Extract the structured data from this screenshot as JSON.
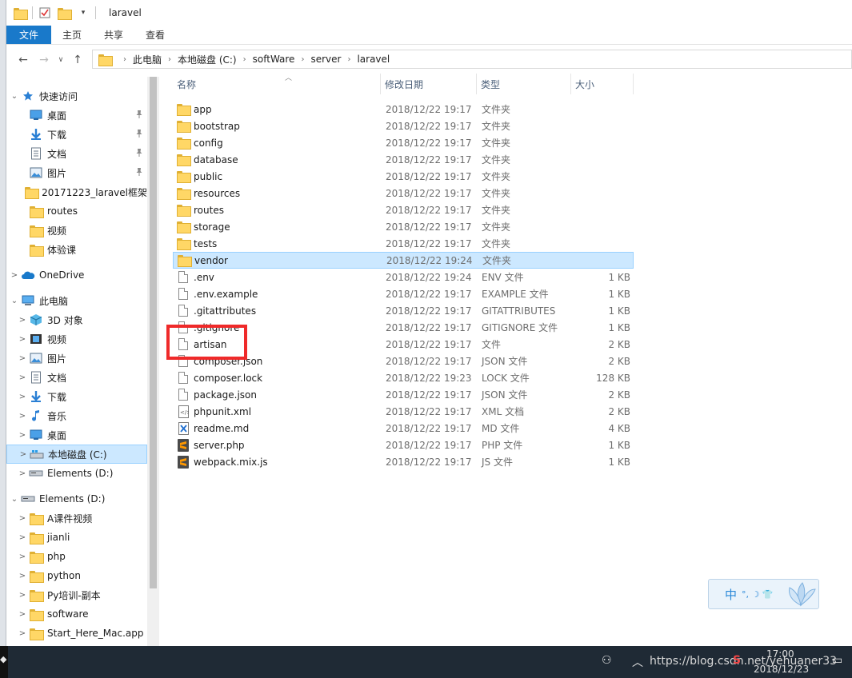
{
  "window": {
    "title": "laravel"
  },
  "ribbon": {
    "tabs": [
      "文件",
      "主页",
      "共享",
      "查看"
    ]
  },
  "address": {
    "crumbs": [
      "此电脑",
      "本地磁盘 (C:)",
      "softWare",
      "server",
      "laravel"
    ]
  },
  "sidebar": {
    "items": [
      {
        "label": "快速访问",
        "icon": "star-icon",
        "caret": "⌄",
        "pinned": false,
        "selected": false
      },
      {
        "label": "桌面",
        "icon": "desktop-icon",
        "caret": "",
        "pinned": true,
        "selected": false
      },
      {
        "label": "下载",
        "icon": "download-arrow-icon",
        "caret": "",
        "pinned": true,
        "selected": false
      },
      {
        "label": "文档",
        "icon": "document-icon",
        "caret": "",
        "pinned": true,
        "selected": false
      },
      {
        "label": "图片",
        "icon": "picture-icon",
        "caret": "",
        "pinned": true,
        "selected": false
      },
      {
        "label": "20171223_laravel框架",
        "icon": "folder-icon",
        "caret": "",
        "pinned": false,
        "selected": false
      },
      {
        "label": "routes",
        "icon": "folder-icon",
        "caret": "",
        "pinned": false,
        "selected": false
      },
      {
        "label": "视频",
        "icon": "folder-icon",
        "caret": "",
        "pinned": false,
        "selected": false
      },
      {
        "label": "体验课",
        "icon": "folder-icon",
        "caret": "",
        "pinned": false,
        "selected": false
      },
      {
        "label": "OneDrive",
        "icon": "cloud-icon",
        "caret": ">",
        "pinned": false,
        "selected": false
      },
      {
        "label": "此电脑",
        "icon": "computer-icon",
        "caret": "⌄",
        "pinned": false,
        "selected": false
      },
      {
        "label": "3D 对象",
        "icon": "cube-3d-icon",
        "caret": ">",
        "pinned": false,
        "selected": false
      },
      {
        "label": "视频",
        "icon": "video-icon",
        "caret": ">",
        "pinned": false,
        "selected": false
      },
      {
        "label": "图片",
        "icon": "picture-icon",
        "caret": ">",
        "pinned": false,
        "selected": false
      },
      {
        "label": "文档",
        "icon": "document-icon",
        "caret": ">",
        "pinned": false,
        "selected": false
      },
      {
        "label": "下载",
        "icon": "download-arrow-icon",
        "caret": ">",
        "pinned": false,
        "selected": false
      },
      {
        "label": "音乐",
        "icon": "music-note-icon",
        "caret": ">",
        "pinned": false,
        "selected": false
      },
      {
        "label": "桌面",
        "icon": "desktop-icon",
        "caret": ">",
        "pinned": false,
        "selected": false
      },
      {
        "label": "本地磁盘 (C:)",
        "icon": "drive-c-icon",
        "caret": ">",
        "pinned": false,
        "selected": true
      },
      {
        "label": "Elements (D:)",
        "icon": "drive-icon",
        "caret": ">",
        "pinned": false,
        "selected": false
      },
      {
        "label": "Elements (D:)",
        "icon": "drive-icon",
        "caret": "⌄",
        "pinned": false,
        "selected": false
      },
      {
        "label": "A课件视频",
        "icon": "folder-icon",
        "caret": ">",
        "pinned": false,
        "selected": false
      },
      {
        "label": "jianli",
        "icon": "folder-icon",
        "caret": ">",
        "pinned": false,
        "selected": false
      },
      {
        "label": "php",
        "icon": "folder-icon",
        "caret": ">",
        "pinned": false,
        "selected": false
      },
      {
        "label": "python",
        "icon": "folder-icon",
        "caret": ">",
        "pinned": false,
        "selected": false
      },
      {
        "label": "Py培训-副本",
        "icon": "folder-icon",
        "caret": ">",
        "pinned": false,
        "selected": false
      },
      {
        "label": "software",
        "icon": "folder-icon",
        "caret": ">",
        "pinned": false,
        "selected": false
      },
      {
        "label": "Start_Here_Mac.app",
        "icon": "folder-icon",
        "caret": ">",
        "pinned": false,
        "selected": false
      }
    ]
  },
  "columns": {
    "name": "名称",
    "date": "修改日期",
    "type": "类型",
    "size": "大小"
  },
  "files": [
    {
      "name": "app",
      "date": "2018/12/22 19:17",
      "type": "文件夹",
      "size": "",
      "icon": "folder-icon"
    },
    {
      "name": "bootstrap",
      "date": "2018/12/22 19:17",
      "type": "文件夹",
      "size": "",
      "icon": "folder-icon"
    },
    {
      "name": "config",
      "date": "2018/12/22 19:17",
      "type": "文件夹",
      "size": "",
      "icon": "folder-icon"
    },
    {
      "name": "database",
      "date": "2018/12/22 19:17",
      "type": "文件夹",
      "size": "",
      "icon": "folder-icon"
    },
    {
      "name": "public",
      "date": "2018/12/22 19:17",
      "type": "文件夹",
      "size": "",
      "icon": "folder-icon"
    },
    {
      "name": "resources",
      "date": "2018/12/22 19:17",
      "type": "文件夹",
      "size": "",
      "icon": "folder-icon"
    },
    {
      "name": "routes",
      "date": "2018/12/22 19:17",
      "type": "文件夹",
      "size": "",
      "icon": "folder-icon"
    },
    {
      "name": "storage",
      "date": "2018/12/22 19:17",
      "type": "文件夹",
      "size": "",
      "icon": "folder-icon"
    },
    {
      "name": "tests",
      "date": "2018/12/22 19:17",
      "type": "文件夹",
      "size": "",
      "icon": "folder-icon"
    },
    {
      "name": "vendor",
      "date": "2018/12/22 19:24",
      "type": "文件夹",
      "size": "",
      "icon": "folder-icon",
      "selected": true
    },
    {
      "name": ".env",
      "date": "2018/12/22 19:24",
      "type": "ENV 文件",
      "size": "1 KB",
      "icon": "file-icon"
    },
    {
      "name": ".env.example",
      "date": "2018/12/22 19:17",
      "type": "EXAMPLE 文件",
      "size": "1 KB",
      "icon": "file-icon"
    },
    {
      "name": ".gitattributes",
      "date": "2018/12/22 19:17",
      "type": "GITATTRIBUTES",
      "size": "1 KB",
      "icon": "file-icon"
    },
    {
      "name": ".gitignore",
      "date": "2018/12/22 19:17",
      "type": "GITIGNORE 文件",
      "size": "1 KB",
      "icon": "file-icon"
    },
    {
      "name": "artisan",
      "date": "2018/12/22 19:17",
      "type": "文件",
      "size": "2 KB",
      "icon": "file-icon"
    },
    {
      "name": "composer.json",
      "date": "2018/12/22 19:17",
      "type": "JSON 文件",
      "size": "2 KB",
      "icon": "file-icon"
    },
    {
      "name": "composer.lock",
      "date": "2018/12/22 19:23",
      "type": "LOCK 文件",
      "size": "128 KB",
      "icon": "file-icon"
    },
    {
      "name": "package.json",
      "date": "2018/12/22 19:17",
      "type": "JSON 文件",
      "size": "2 KB",
      "icon": "file-icon"
    },
    {
      "name": "phpunit.xml",
      "date": "2018/12/22 19:17",
      "type": "XML 文档",
      "size": "2 KB",
      "icon": "xml-file-icon"
    },
    {
      "name": "readme.md",
      "date": "2018/12/22 19:17",
      "type": "MD 文件",
      "size": "4 KB",
      "icon": "md-file-icon"
    },
    {
      "name": "server.php",
      "date": "2018/12/22 19:17",
      "type": "PHP 文件",
      "size": "1 KB",
      "icon": "sublime-file-icon"
    },
    {
      "name": "webpack.mix.js",
      "date": "2018/12/22 19:17",
      "type": "JS 文件",
      "size": "1 KB",
      "icon": "sublime-file-icon"
    }
  ],
  "ime": {
    "label": "中",
    "symbols": "°, ☽ 👕"
  },
  "taskbar": {
    "overlay_text": "https://blog.csdn.net/yehuaner33",
    "time": "17:00",
    "date": "2018/12/23"
  },
  "colors": {
    "accent": "#1979ca",
    "selection": "#cce8ff",
    "highlight": "#ef2a2a",
    "folder": "#ffd766"
  }
}
